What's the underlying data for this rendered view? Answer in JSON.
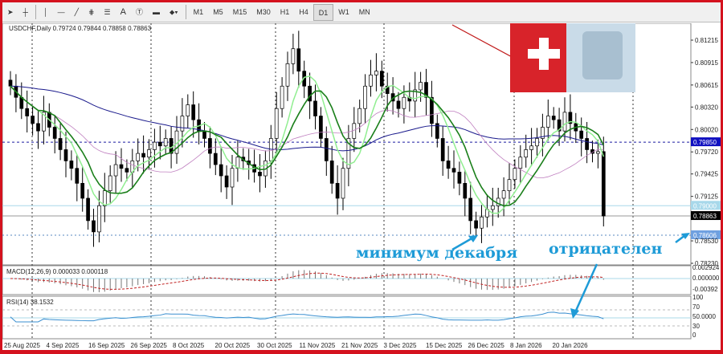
{
  "toolbar": {
    "tools": [
      "cursor",
      "crosshair",
      "vertical-line",
      "horizontal-line",
      "trendline",
      "fibonacci",
      "fibo-levels",
      "text",
      "text-label",
      "rectangle",
      "arrows"
    ],
    "text_tool": "A",
    "timeframes": [
      "M1",
      "M5",
      "M15",
      "M30",
      "H1",
      "H4",
      "D1",
      "W1",
      "MN"
    ],
    "selected": "D1"
  },
  "chart_header": "USDCHF,Daily  0.79724 0.79844 0.78858 0.78863",
  "macd_label": "MACD(12,26,9) 0.000033 0.000118",
  "rsi_label": "RSI(14) 38.1532",
  "annotations": {
    "december_low": "минимум декабря",
    "negative": "отрицателен"
  },
  "colors": {
    "accent": "#1e9bd7",
    "frame": "#d4121e",
    "ma_dark": "#1a7f1a",
    "ma_light": "#90ee90",
    "ma_purple": "#c080c0",
    "ma_navy": "#1a1a8c"
  },
  "chart_data": {
    "type": "candlestick",
    "symbol": "USDCHF",
    "timeframe": "Daily",
    "price_ticks": [
      "0.81215",
      "0.80915",
      "0.80615",
      "0.80320",
      "0.80020",
      "0.79720",
      "0.79425",
      "0.79125",
      "0.78530",
      "0.78230"
    ],
    "price_labels": {
      "blue_line": "0.79850",
      "light_line": "0.79000",
      "current": "0.78863",
      "dotted": "0.78606"
    },
    "macd_ticks": [
      "0.002924",
      "0.000000",
      "-0.00392"
    ],
    "rsi_ticks": [
      "100",
      "70",
      "50.0000",
      "30",
      "0"
    ],
    "date_ticks": [
      "25 Aug 2025",
      "4 Sep 2025",
      "16 Sep 2025",
      "26 Sep 2025",
      "8 Oct 2025",
      "20 Oct 2025",
      "30 Oct 2025",
      "11 Nov 2025",
      "21 Nov 2025",
      "3 Dec 2025",
      "15 Dec 2025",
      "26 Dec 2025",
      "8 Jan 2026",
      "20 Jan 2026"
    ],
    "ylim": [
      0.78,
      0.814
    ],
    "closes": [
      0.806,
      0.8045,
      0.803,
      0.802,
      0.801,
      0.8,
      0.8025,
      0.8005,
      0.799,
      0.7975,
      0.796,
      0.795,
      0.793,
      0.791,
      0.788,
      0.7865,
      0.79,
      0.792,
      0.794,
      0.7955,
      0.795,
      0.7945,
      0.796,
      0.797,
      0.7965,
      0.7975,
      0.7985,
      0.798,
      0.799,
      0.797,
      0.8,
      0.802,
      0.8035,
      0.8015,
      0.8,
      0.799,
      0.797,
      0.7955,
      0.794,
      0.7925,
      0.795,
      0.7965,
      0.796,
      0.7955,
      0.7945,
      0.794,
      0.796,
      0.799,
      0.803,
      0.806,
      0.809,
      0.811,
      0.808,
      0.806,
      0.804,
      0.802,
      0.799,
      0.796,
      0.793,
      0.791,
      0.795,
      0.799,
      0.801,
      0.803,
      0.806,
      0.8075,
      0.808,
      0.806,
      0.805,
      0.804,
      0.803,
      0.8045,
      0.804,
      0.8055,
      0.8065,
      0.8045,
      0.801,
      0.799,
      0.796,
      0.795,
      0.7945,
      0.793,
      0.791,
      0.788,
      0.787,
      0.7885,
      0.7895,
      0.79,
      0.791,
      0.792,
      0.7935,
      0.795,
      0.7965,
      0.7975,
      0.798,
      0.799,
      0.8005,
      0.802,
      0.8015,
      0.8,
      0.8025,
      0.801,
      0.8,
      0.799,
      0.7975,
      0.797,
      0.79724,
      0.78863
    ]
  }
}
